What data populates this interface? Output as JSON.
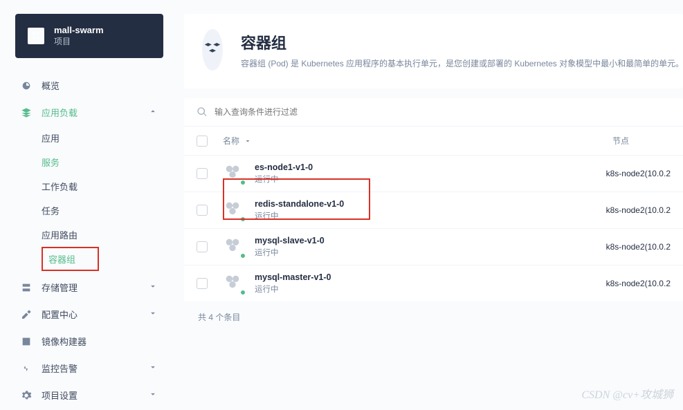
{
  "project": {
    "name": "mall-swarm",
    "sub": "项目"
  },
  "sidebar": {
    "overview": "概览",
    "workload": "应用负载",
    "workload_children": [
      "应用",
      "服务",
      "工作负载",
      "任务",
      "应用路由",
      "容器组"
    ],
    "storage": "存储管理",
    "config": "配置中心",
    "image": "镜像构建器",
    "monitor": "监控告警",
    "settings": "项目设置"
  },
  "header": {
    "title": "容器组",
    "desc": "容器组 (Pod) 是 Kubernetes 应用程序的基本执行单元，是您创建或部署的 Kubernetes 对象模型中最小和最简单的单元。"
  },
  "search": {
    "placeholder": "输入查询条件进行过滤"
  },
  "columns": {
    "name": "名称",
    "node": "节点"
  },
  "rows": [
    {
      "name": "es-node1-v1-0",
      "status": "运行中",
      "node": "k8s-node2(10.0.2"
    },
    {
      "name": "redis-standalone-v1-0",
      "status": "运行中",
      "node": "k8s-node2(10.0.2"
    },
    {
      "name": "mysql-slave-v1-0",
      "status": "运行中",
      "node": "k8s-node2(10.0.2"
    },
    {
      "name": "mysql-master-v1-0",
      "status": "运行中",
      "node": "k8s-node2(10.0.2"
    }
  ],
  "footer": "共 4 个条目",
  "watermark": "CSDN @cv+攻城狮"
}
